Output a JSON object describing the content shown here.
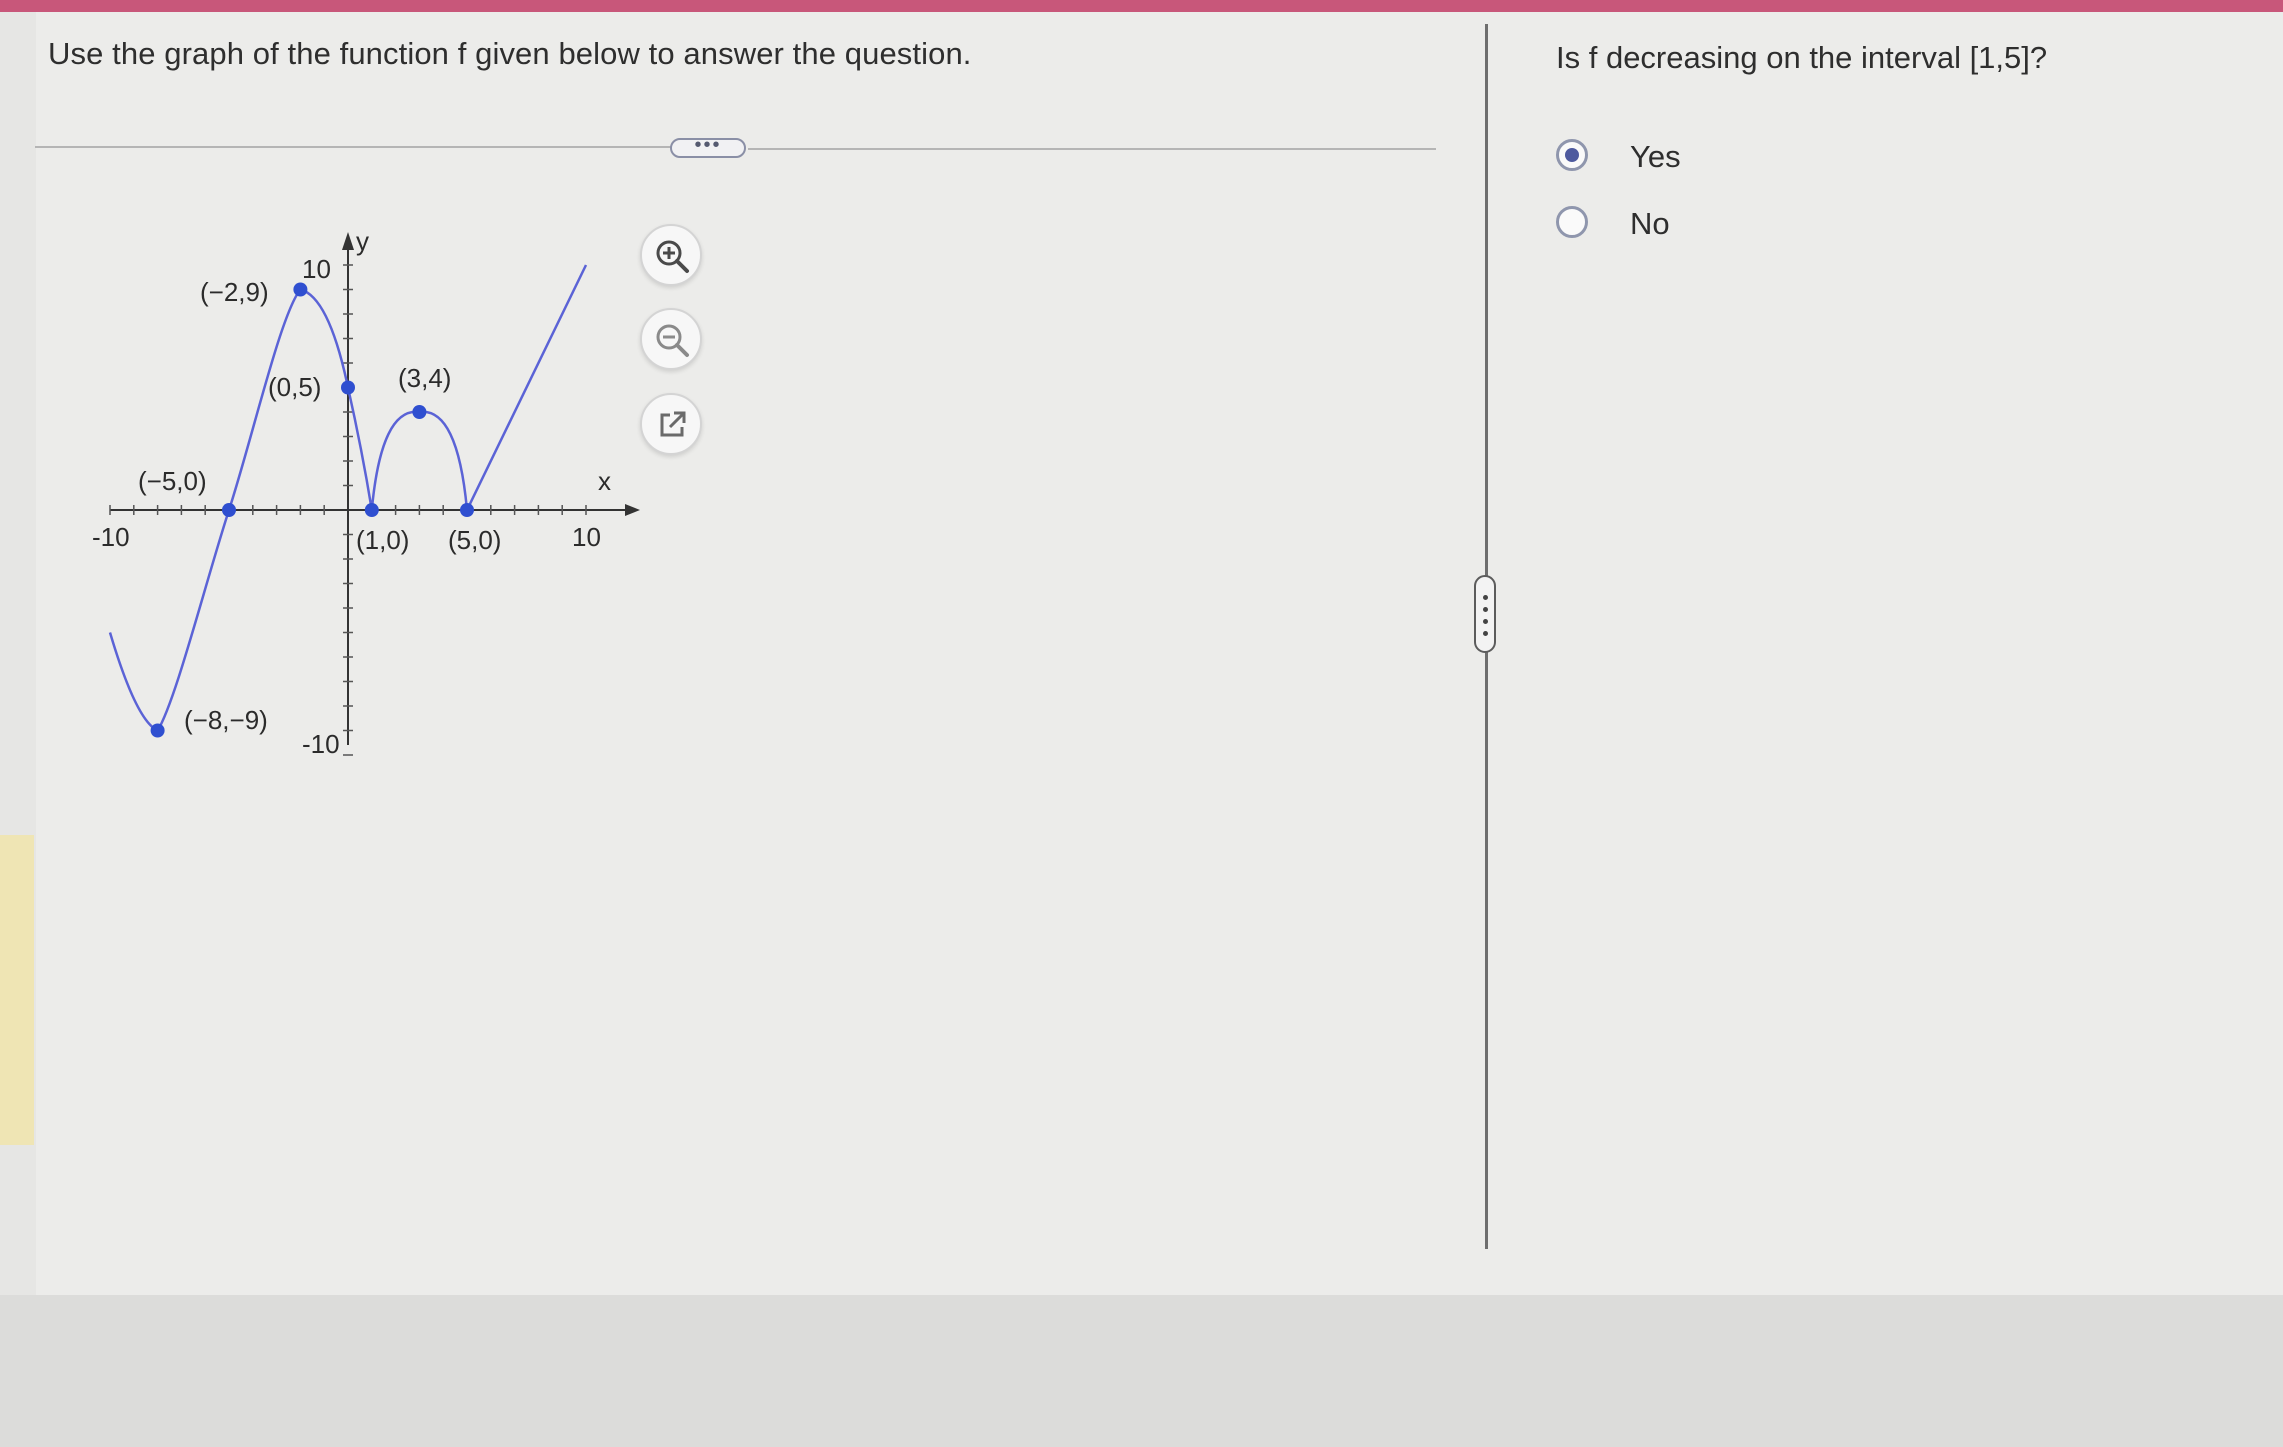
{
  "question": {
    "prompt": "Use the graph of the function f given below to answer the question.",
    "sub_question": "Is f decreasing on the interval [1,5]?"
  },
  "answer_choices": [
    {
      "label": "Yes",
      "selected": true
    },
    {
      "label": "No",
      "selected": false
    }
  ],
  "graph": {
    "x_axis_label": "x",
    "y_axis_label": "y",
    "tick_labels": {
      "x_min": "-10",
      "x_max": "10",
      "y_max": "10",
      "y_min": "-10"
    },
    "curve_color": "#5b63d6",
    "point_color": "#2f4fd0",
    "points": [
      {
        "x": -8,
        "y": -9,
        "label": "(−8,−9)"
      },
      {
        "x": -5,
        "y": 0,
        "label": "(−5,0)"
      },
      {
        "x": -2,
        "y": 9,
        "label": "(−2,9)"
      },
      {
        "x": 0,
        "y": 5,
        "label": "(0,5)"
      },
      {
        "x": 1,
        "y": 0,
        "label": "(1,0)"
      },
      {
        "x": 3,
        "y": 4,
        "label": "(3,4)"
      },
      {
        "x": 5,
        "y": 0,
        "label": "(5,0)"
      }
    ],
    "curve_start": {
      "x": -10,
      "y": -5
    },
    "curve_end": {
      "x": 10,
      "y": 10
    }
  },
  "toolbar": {
    "icons": [
      "zoom-in-icon",
      "zoom-out-icon",
      "external-link-icon"
    ],
    "expand_handle_label": "•••"
  },
  "colors": {
    "top_bar": "#c8577a",
    "radio_selected": "#4e5a9e"
  }
}
